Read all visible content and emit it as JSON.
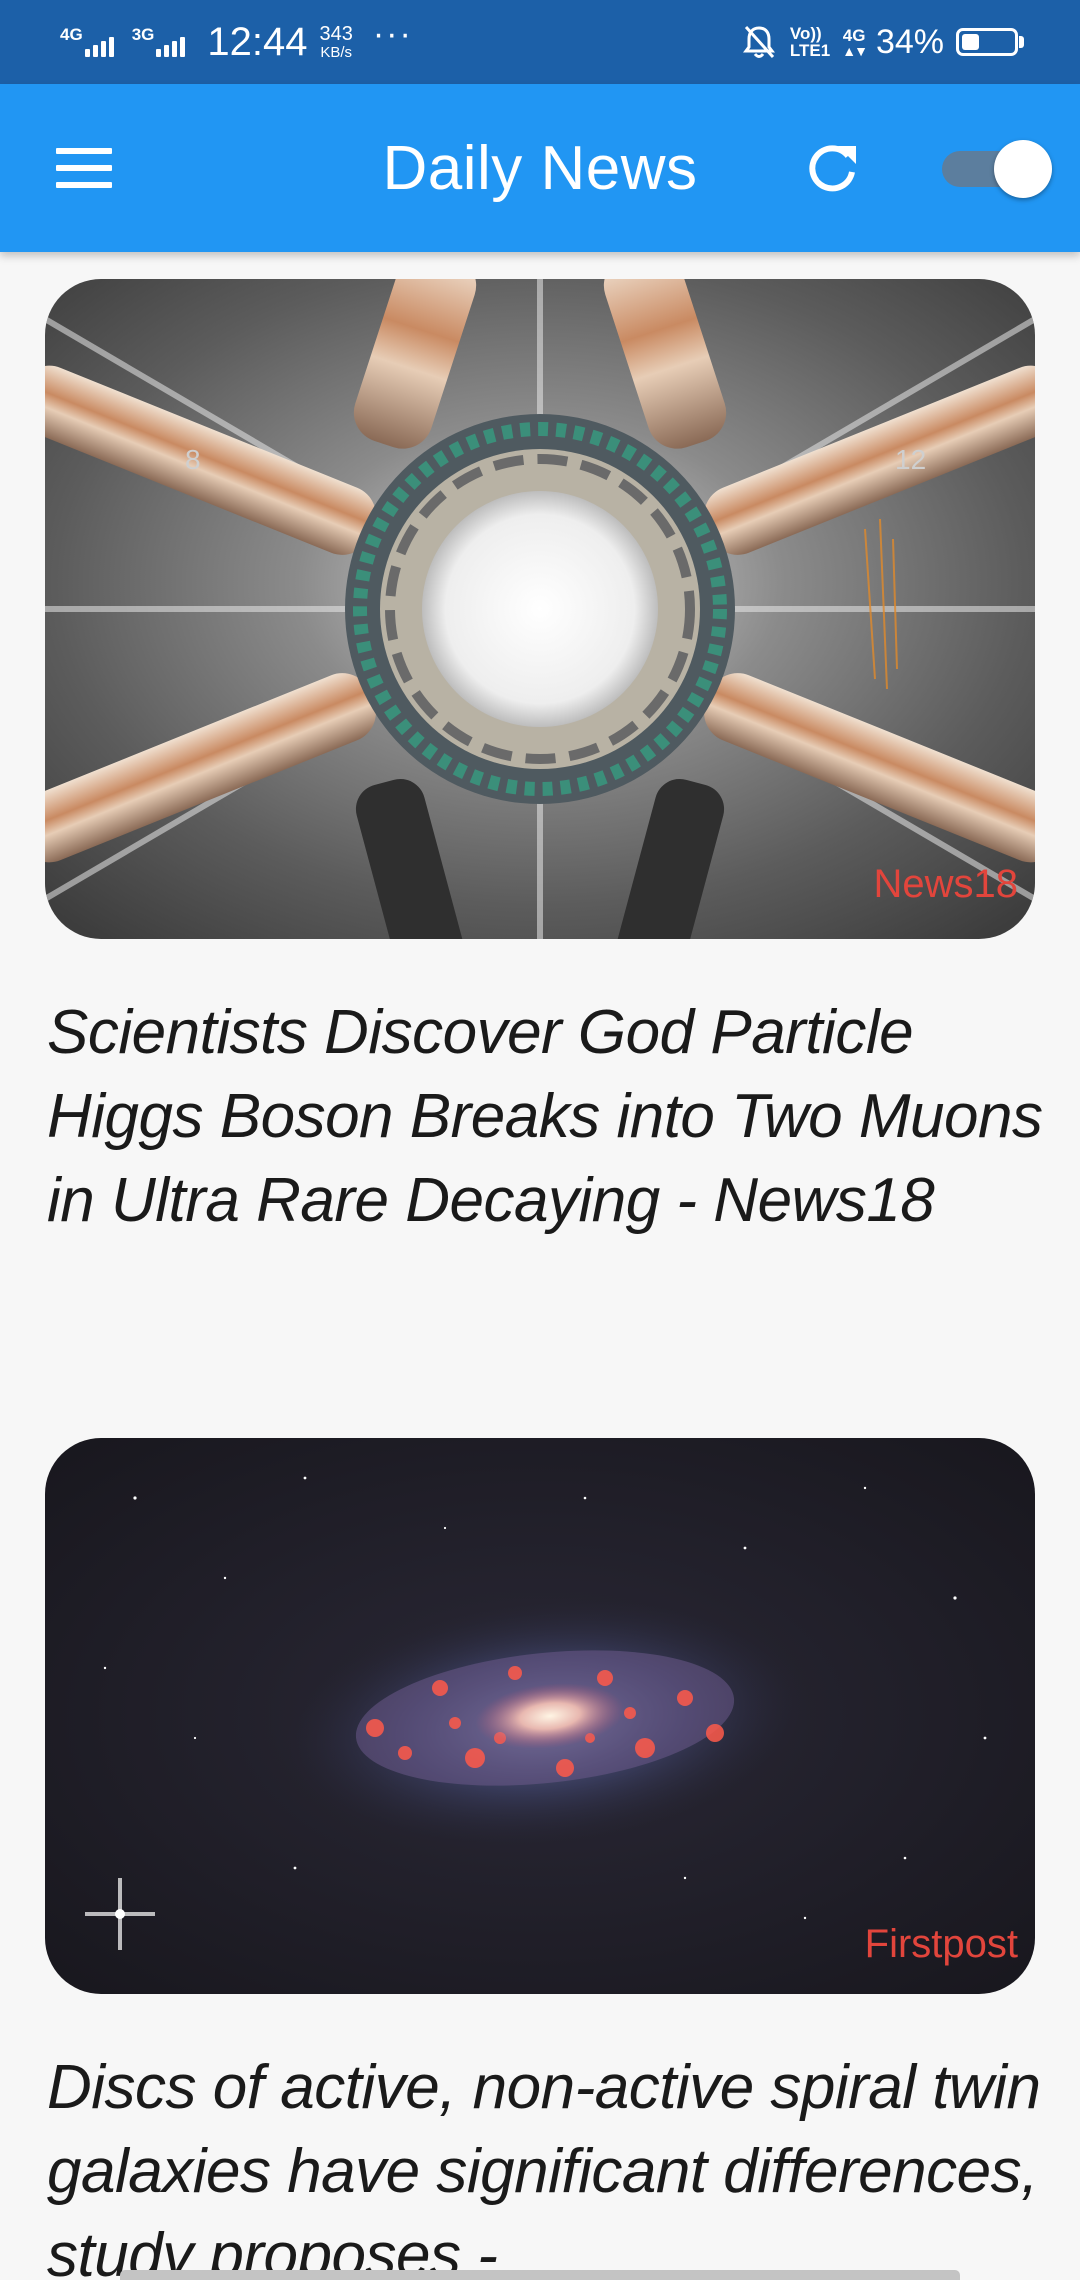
{
  "status_bar": {
    "network_1": "4G",
    "network_2": "3G",
    "time": "12:44",
    "speed_value": "343",
    "speed_unit": "KB/s",
    "overflow": "···",
    "volte_top": "Vo))",
    "volte_bottom": "LTE1",
    "network_right": "4G",
    "battery_percent": "34%",
    "battery_level": 0.34
  },
  "app_bar": {
    "title": "Daily News",
    "background_color": "#2196f3",
    "menu_icon": "hamburger-menu-icon",
    "refresh_icon": "refresh-icon",
    "toggle_on": true
  },
  "articles": [
    {
      "source": "News18",
      "headline": "Scientists Discover God Particle Higgs Boson Breaks into Two Muons in Ultra Rare Decaying - News18",
      "image": "particle-detector-image"
    },
    {
      "source": "Firstpost",
      "headline": "Discs of active, non-active spiral twin galaxies have significant differences, study proposes -",
      "image": "spiral-galaxy-image"
    }
  ],
  "colors": {
    "source_label": "#e2453c",
    "status_bar": "#1c60a8"
  }
}
